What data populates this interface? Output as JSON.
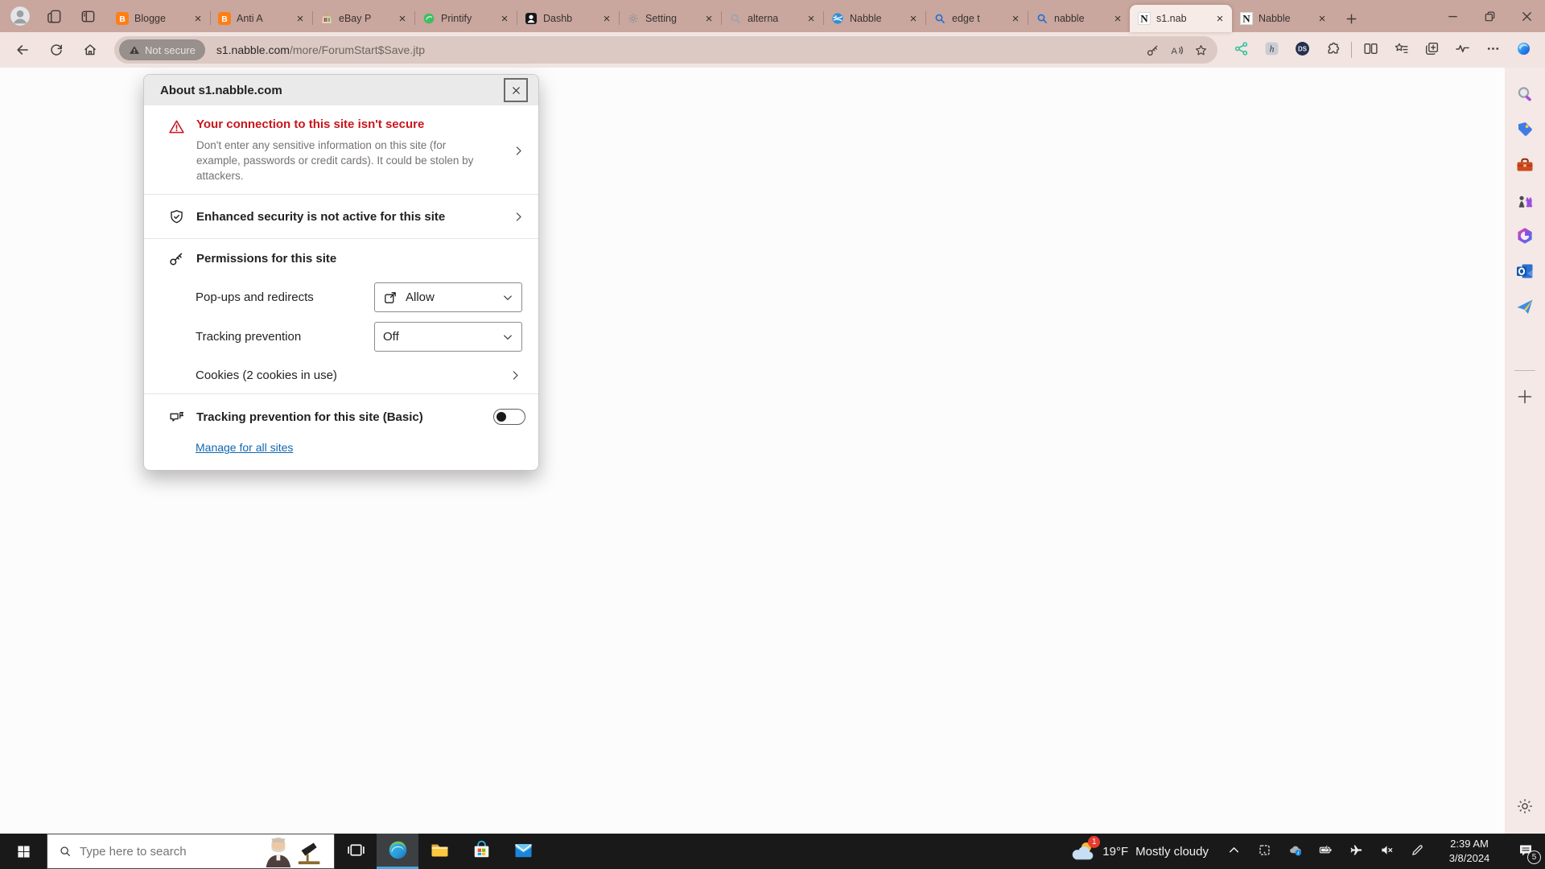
{
  "colors": {
    "tab_bar_bg": "#C9A69E",
    "toolbar_bg": "#F2E4E0",
    "active_tab_bg": "#F6EBE7",
    "urlbar_bg": "#DCC9C4",
    "security_chip_bg": "#97908D",
    "taskbar_bg": "#191919",
    "warning_red": "#C8161D",
    "link_blue": "#1167B1",
    "taskbar_accent": "#47A7E0"
  },
  "tab_bar": {
    "tabs": [
      {
        "title": "Blogge",
        "icon": "fav-blogger",
        "active": false
      },
      {
        "title": "Anti A",
        "icon": "fav-blogger",
        "active": false
      },
      {
        "title": "eBay P",
        "icon": "fav-ebay",
        "active": false
      },
      {
        "title": "Printify",
        "icon": "fav-printify",
        "active": false
      },
      {
        "title": "Dashb",
        "icon": "fav-dashboard",
        "active": false
      },
      {
        "title": "Setting",
        "icon": "fav-gear",
        "active": false
      },
      {
        "title": "alterna",
        "icon": "fav-search-gray",
        "active": false
      },
      {
        "title": "Nabble",
        "icon": "fav-globe",
        "active": false
      },
      {
        "title": "edge t",
        "icon": "fav-search-blue",
        "active": false
      },
      {
        "title": "nabble",
        "icon": "fav-search-blue",
        "active": false
      },
      {
        "title": "s1.nab",
        "icon": "fav-letter-n",
        "active": true
      },
      {
        "title": "Nabble",
        "icon": "fav-letter-n",
        "active": false
      }
    ]
  },
  "toolbar": {
    "security_chip": "Not secure",
    "url_domain": "s1.nabble.com",
    "url_path": "/more/ForumStart$Save.jtp",
    "action_icons": [
      "share",
      "honey",
      "ds",
      "extensions",
      "divider",
      "split-screen",
      "favorites",
      "collections",
      "essentials",
      "more",
      "copilot"
    ]
  },
  "dialog": {
    "title": "About s1.nabble.com",
    "warning": {
      "title": "Your connection to this site isn't secure",
      "body": "Don't enter any sensitive information on this site (for example, passwords or credit cards). It could be stolen by attackers."
    },
    "enhanced_security": "Enhanced security is not active for this site",
    "permissions": {
      "header": "Permissions for this site",
      "rows": [
        {
          "label": "Pop-ups and redirects",
          "value": "Allow",
          "icon": "popup-icon"
        },
        {
          "label": "Tracking prevention",
          "value": "Off",
          "icon": null
        }
      ],
      "cookies": "Cookies (2 cookies in use)"
    },
    "tracking_toggle": {
      "label": "Tracking prevention for this site (Basic)",
      "state": "off"
    },
    "manage_link": "Manage for all sites"
  },
  "sidebar": {
    "items": [
      "search",
      "shopping",
      "tools",
      "games",
      "microsoft-365",
      "outlook",
      "drop"
    ]
  },
  "taskbar": {
    "search_placeholder": "Type here to search",
    "apps": [
      "task-view",
      "edge",
      "file-explorer",
      "microsoft-store",
      "mail"
    ],
    "active_app": "edge",
    "weather": {
      "temp": "19°F",
      "condition": "Mostly cloudy",
      "badge": "1"
    },
    "tray": [
      "chevron-up",
      "tablet",
      "onedrive",
      "battery",
      "airplane",
      "volume-mute",
      "pen"
    ],
    "clock": {
      "time": "2:39 AM",
      "date": "3/8/2024"
    },
    "notifications": "5"
  }
}
